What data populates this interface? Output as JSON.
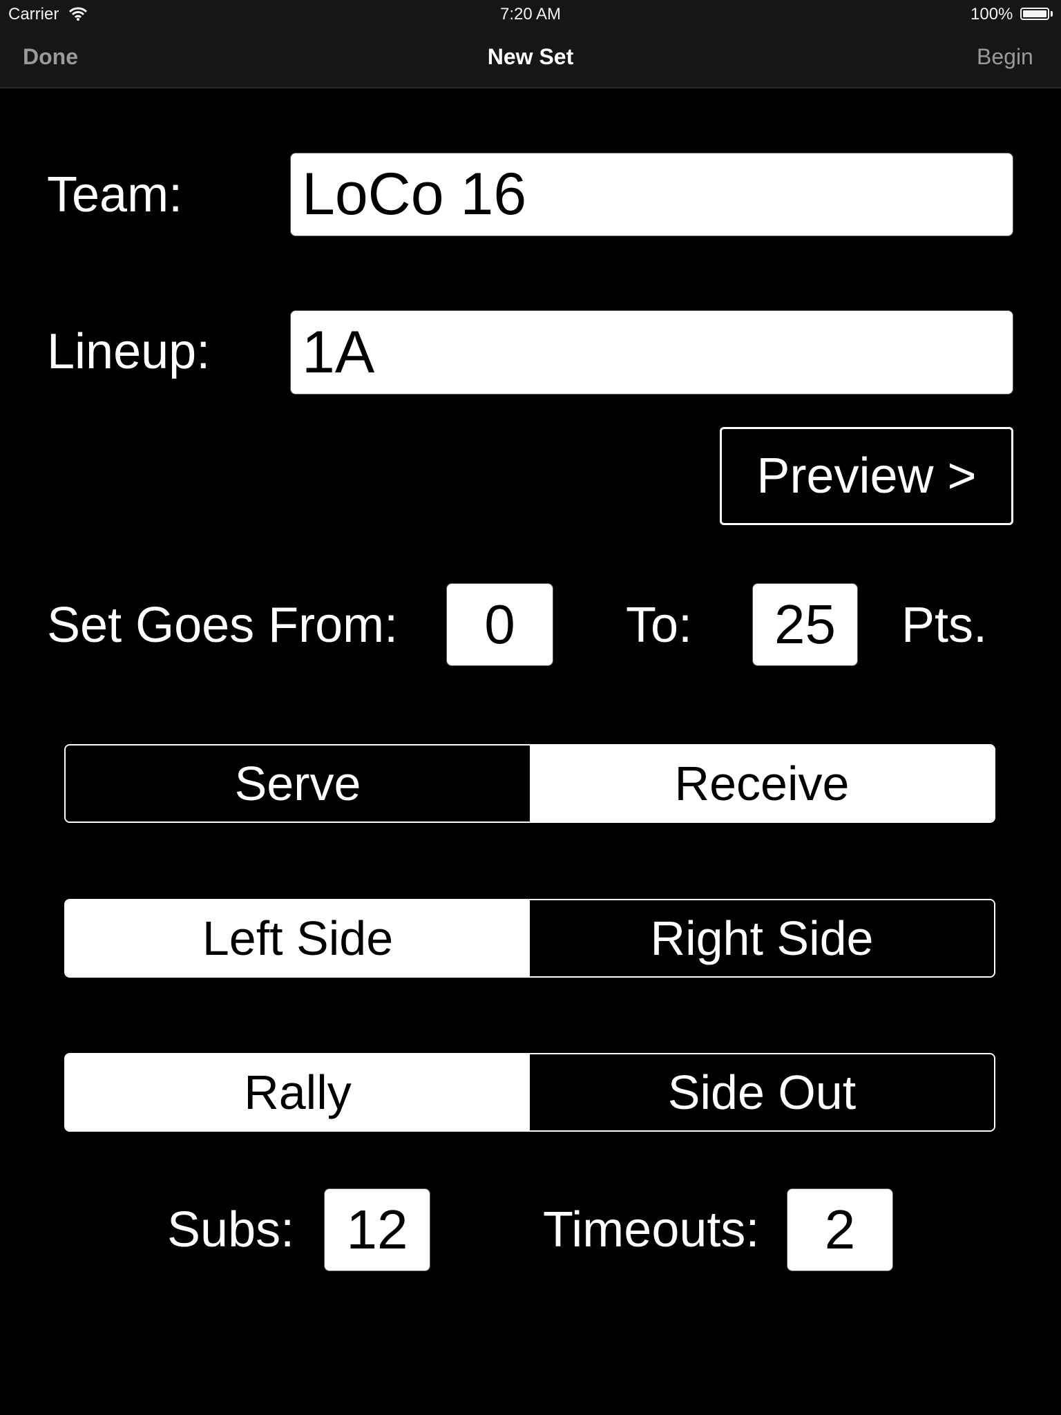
{
  "status_bar": {
    "carrier": "Carrier",
    "time": "7:20 AM",
    "battery": "100%",
    "battery_level": 1.0
  },
  "nav": {
    "left_button": "Done",
    "title": "New Set",
    "right_button": "Begin"
  },
  "form": {
    "team_label": "Team:",
    "team_value": "LoCo 16",
    "lineup_label": "Lineup:",
    "lineup_value": "1A",
    "preview_button": "Preview >",
    "set_from_label": "Set Goes From:",
    "set_from_value": "0",
    "set_to_label": "To:",
    "set_to_value": "25",
    "pts_label": "Pts.",
    "subs_label": "Subs:",
    "subs_value": "12",
    "timeouts_label": "Timeouts:",
    "timeouts_value": "2"
  },
  "segments": {
    "serve_receive": {
      "options": [
        "Serve",
        "Receive"
      ],
      "selected": "Receive"
    },
    "side": {
      "options": [
        "Left Side",
        "Right Side"
      ],
      "selected": "Left Side"
    },
    "scoring": {
      "options": [
        "Rally",
        "Side Out"
      ],
      "selected": "Rally"
    }
  },
  "colors": {
    "background": "#000000",
    "nav_background": "#161616",
    "nav_button": "#9a9a9a",
    "tint": "#ffffff"
  }
}
